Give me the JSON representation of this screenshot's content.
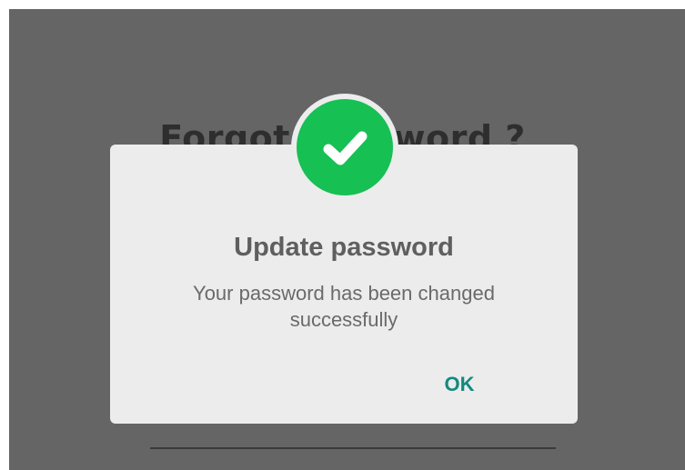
{
  "background": {
    "title": "Forgot Password ?",
    "overlay_color": "#656565"
  },
  "dialog": {
    "icon": "check-circle-icon",
    "icon_color": "#16c053",
    "title": "Update password",
    "message": "Your password has been changed successfully",
    "ok_label": "OK",
    "ok_color": "#138a80"
  }
}
